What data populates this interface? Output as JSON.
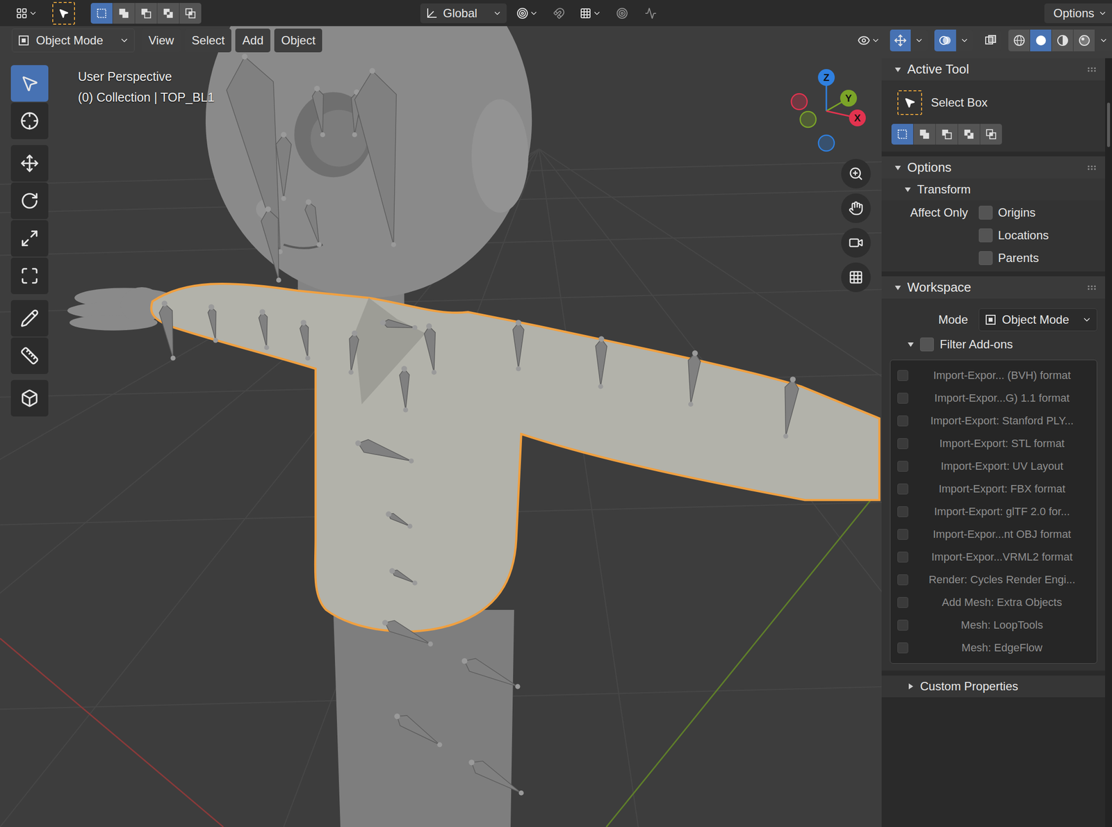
{
  "top_bar": {
    "select_modes": [
      {
        "kind": "set",
        "selected": true
      },
      {
        "kind": "extend",
        "selected": false
      },
      {
        "kind": "subtract",
        "selected": false
      },
      {
        "kind": "difference",
        "selected": false
      },
      {
        "kind": "intersect",
        "selected": false
      }
    ],
    "orientation": "Global",
    "snap": {
      "on": false
    },
    "proportional": {
      "on": false
    },
    "options": "Options"
  },
  "viewport_header": {
    "mode": "Object Mode",
    "menus": [
      "View",
      "Select",
      "Add",
      "Object"
    ],
    "gizmos_on": true,
    "overlays_on": true,
    "xray_on": false,
    "shading": [
      {
        "kind": "wireframe",
        "selected": false
      },
      {
        "kind": "solid",
        "selected": true
      },
      {
        "kind": "material",
        "selected": false
      },
      {
        "kind": "rendered",
        "selected": false
      }
    ]
  },
  "viewport": {
    "view_name": "User Perspective",
    "collection": "(0) Collection | TOP_BL1"
  },
  "gizmo": {
    "axes": [
      {
        "label": "Z",
        "color": "#2f80e0"
      },
      {
        "label": "Y",
        "color": "#7ba428"
      },
      {
        "label": "X",
        "color": "#e2334f"
      }
    ]
  },
  "toolbar": {
    "groups": [
      [
        {
          "kind": "select",
          "selected": true
        },
        {
          "kind": "cursor",
          "selected": false
        }
      ],
      [
        {
          "kind": "move",
          "selected": false
        },
        {
          "kind": "rotate",
          "selected": false
        },
        {
          "kind": "scale",
          "selected": false
        },
        {
          "kind": "transform",
          "selected": false
        }
      ],
      [
        {
          "kind": "annotate",
          "selected": false
        },
        {
          "kind": "measure",
          "selected": false
        }
      ],
      [
        {
          "kind": "add",
          "selected": false
        }
      ]
    ]
  },
  "sidebar": {
    "panels": [
      {
        "kind": "tool",
        "title": "Active Tool",
        "expanded": true,
        "tool": "Select Box",
        "modes": [
          {
            "kind": "set",
            "selected": true
          },
          {
            "kind": "extend",
            "selected": false
          },
          {
            "kind": "subtract",
            "selected": false
          },
          {
            "kind": "difference",
            "selected": false
          },
          {
            "kind": "intersect",
            "selected": false
          }
        ]
      },
      {
        "kind": "options",
        "title": "Options",
        "expanded": true,
        "subpanel": {
          "title": "Transform",
          "expanded": true,
          "label": "Affect Only",
          "options": [
            {
              "label": "Origins",
              "checked": false
            },
            {
              "label": "Locations",
              "checked": false
            },
            {
              "label": "Parents",
              "checked": false
            }
          ]
        }
      },
      {
        "kind": "workspace",
        "title": "Workspace",
        "expanded": true,
        "mode_label": "Mode",
        "mode": "Object Mode",
        "filter": {
          "label": "Filter Add-ons",
          "checked": false,
          "expanded": true
        },
        "addons": [
          {
            "label": "Import-Expor... (BVH) format",
            "checked": false,
            "disabled": true
          },
          {
            "label": "Import-Expor...G) 1.1 format",
            "checked": false,
            "disabled": true
          },
          {
            "label": "Import-Export: Stanford PLY...",
            "checked": false,
            "disabled": true
          },
          {
            "label": "Import-Export: STL format",
            "checked": false,
            "disabled": true
          },
          {
            "label": "Import-Export: UV Layout",
            "checked": false,
            "disabled": true
          },
          {
            "label": "Import-Export: FBX format",
            "checked": false,
            "disabled": true
          },
          {
            "label": "Import-Export: glTF 2.0 for...",
            "checked": false,
            "disabled": true
          },
          {
            "label": "Import-Expor...nt OBJ format",
            "checked": false,
            "disabled": true
          },
          {
            "label": "Import-Expor...VRML2 format",
            "checked": false,
            "disabled": true
          },
          {
            "label": "Render: Cycles Render Engi...",
            "checked": false,
            "disabled": true
          },
          {
            "label": "Add Mesh: Extra Objects",
            "checked": false,
            "disabled": true
          },
          {
            "label": "Mesh: LoopTools",
            "checked": false,
            "disabled": true
          },
          {
            "label": "Mesh: EdgeFlow",
            "checked": false,
            "disabled": true
          }
        ]
      },
      {
        "kind": "plain",
        "title": "Custom Properties",
        "expanded": false
      }
    ]
  }
}
